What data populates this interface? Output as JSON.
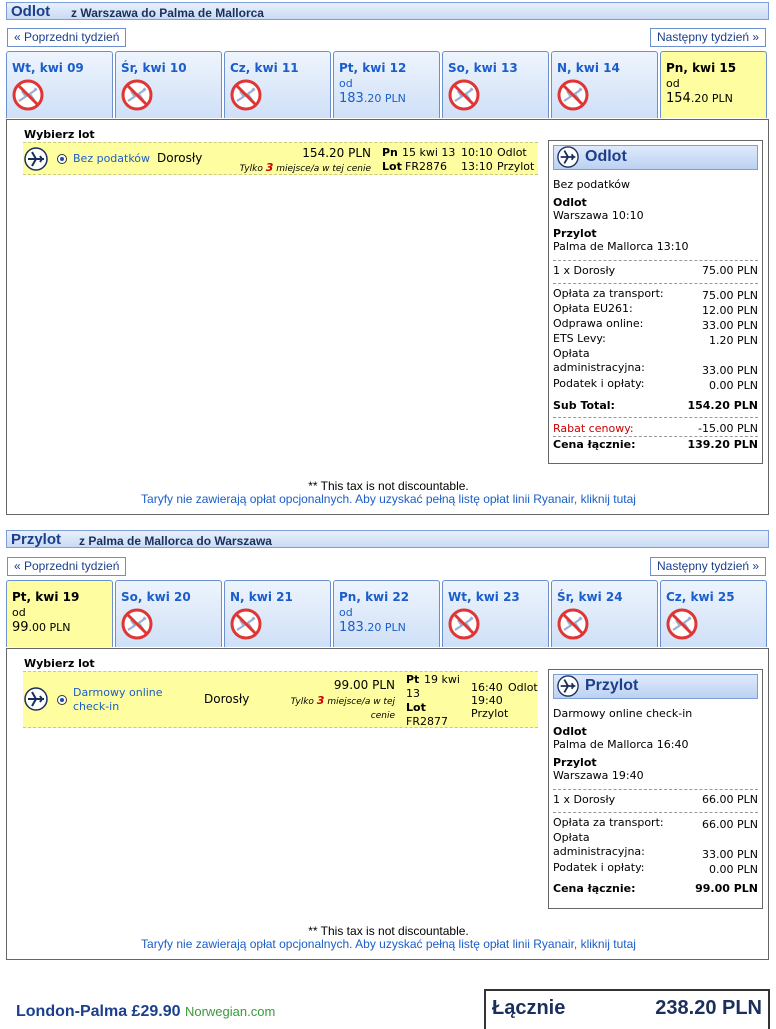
{
  "outbound": {
    "title": "Odlot",
    "route": "z Warszawa do Palma de Mallorca",
    "prev_week": "« Poprzedni tydzień",
    "next_week": "Następny tydzień »",
    "days": [
      {
        "label": "Wt, kwi 09",
        "available": false
      },
      {
        "label": "Śr, kwi 10",
        "available": false
      },
      {
        "label": "Cz, kwi 11",
        "available": false
      },
      {
        "label": "Pt, kwi 12",
        "available": true,
        "od": "od",
        "price_main": "183",
        "price_dec": ".20 PLN"
      },
      {
        "label": "So, kwi 13",
        "available": false
      },
      {
        "label": "N, kwi 14",
        "available": false
      },
      {
        "label": "Pn, kwi 15",
        "available": true,
        "selected": true,
        "od": "od",
        "price_main": "154",
        "price_dec": ".20 PLN"
      }
    ],
    "choose_label": "Wybierz lot",
    "flight": {
      "fare": "Bez podatków",
      "passenger": "Dorosły",
      "price": "154.20 PLN",
      "seats_prefix": "Tylko ",
      "seats_count": "3",
      "seats_suffix": " miejsce/a w tej cenie",
      "day_short": "Pn",
      "date": "15 kwi 13",
      "lot_label": "Lot",
      "flight_no": "FR2876",
      "dep_time": "10:10",
      "dep_label": "Odlot",
      "arr_time": "13:10",
      "arr_label": "Przylot"
    },
    "summary": {
      "title": "Odlot",
      "fare": "Bez podatków",
      "dep_heading": "Odlot",
      "dep_place": "Warszawa 10:10",
      "arr_heading": "Przylot",
      "arr_place": "Palma de Mallorca 13:10",
      "pax_label": "1 x Dorosły",
      "pax_value": "75.00 PLN",
      "fees": [
        {
          "label": "Opłata za transport:",
          "value": "75.00 PLN"
        },
        {
          "label": "Opłata EU261:",
          "value": "12.00 PLN"
        },
        {
          "label": "Odprawa online:",
          "value": "33.00 PLN"
        },
        {
          "label": "ETS Levy:",
          "value": "1.20 PLN"
        },
        {
          "label": "Opłata administracyjna:",
          "value": "33.00 PLN"
        },
        {
          "label": "Podatek i opłaty:",
          "value": "0.00 PLN"
        }
      ],
      "subtotal_label": "Sub Total:",
      "subtotal_value": "154.20 PLN",
      "discount_label": "Rabat cenowy:",
      "discount_value": "-15.00 PLN",
      "total_label": "Cena łącznie:",
      "total_value": "139.20 PLN"
    },
    "tax_note": "** This tax is not discountable.",
    "fees_link": "Taryfy nie zawierają opłat opcjonalnych. Aby uzyskać pełną listę opłat linii Ryanair, kliknij tutaj"
  },
  "inbound": {
    "title": "Przylot",
    "route": "z Palma de Mallorca do Warszawa",
    "prev_week": "« Poprzedni tydzień",
    "next_week": "Następny tydzień »",
    "days": [
      {
        "label": "Pt, kwi 19",
        "available": true,
        "selected": true,
        "od": "od",
        "price_main": "99",
        "price_dec": ".00 PLN"
      },
      {
        "label": "So, kwi 20",
        "available": false
      },
      {
        "label": "N, kwi 21",
        "available": false
      },
      {
        "label": "Pn, kwi 22",
        "available": true,
        "od": "od",
        "price_main": "183",
        "price_dec": ".20 PLN"
      },
      {
        "label": "Wt, kwi 23",
        "available": false
      },
      {
        "label": "Śr, kwi 24",
        "available": false
      },
      {
        "label": "Cz, kwi 25",
        "available": false
      }
    ],
    "choose_label": "Wybierz lot",
    "flight": {
      "fare": "Darmowy online check-in",
      "passenger": "Dorosły",
      "price": "99.00 PLN",
      "seats_prefix": "Tylko ",
      "seats_count": "3",
      "seats_suffix": " miejsce/a w tej cenie",
      "day_short": "Pt",
      "date": "19 kwi 13",
      "lot_label": "Lot",
      "flight_no": "FR2877",
      "dep_time": "16:40",
      "dep_label": "Odlot",
      "arr_time": "19:40",
      "arr_label": "Przylot"
    },
    "summary": {
      "title": "Przylot",
      "fare": "Darmowy online check-in",
      "dep_heading": "Odlot",
      "dep_place": "Palma de Mallorca 16:40",
      "arr_heading": "Przylot",
      "arr_place": "Warszawa 19:40",
      "pax_label": "1 x Dorosły",
      "pax_value": "66.00 PLN",
      "fees": [
        {
          "label": "Opłata za transport:",
          "value": "66.00 PLN"
        },
        {
          "label": "Opłata administracyjna:",
          "value": "33.00 PLN"
        },
        {
          "label": "Podatek i opłaty:",
          "value": "0.00 PLN"
        }
      ],
      "total_label": "Cena łącznie:",
      "total_value": "99.00 PLN"
    },
    "tax_note": "** This tax is not discountable.",
    "fees_link": "Taryfy nie zawierają opłat opcjonalnych. Aby uzyskać pełną listę opłat linii Ryanair, kliknij tutaj"
  },
  "ad": {
    "text": "London-Palma £29.90",
    "brand": "Norwegian.com"
  },
  "grand_total": {
    "label": "Łącznie",
    "value": "238.20 PLN"
  },
  "colors": {
    "header_blue": "#1b3f8c",
    "link_blue": "#1b5ec9",
    "selected_yellow": "#fefea0",
    "warning_red": "#cc0000"
  }
}
